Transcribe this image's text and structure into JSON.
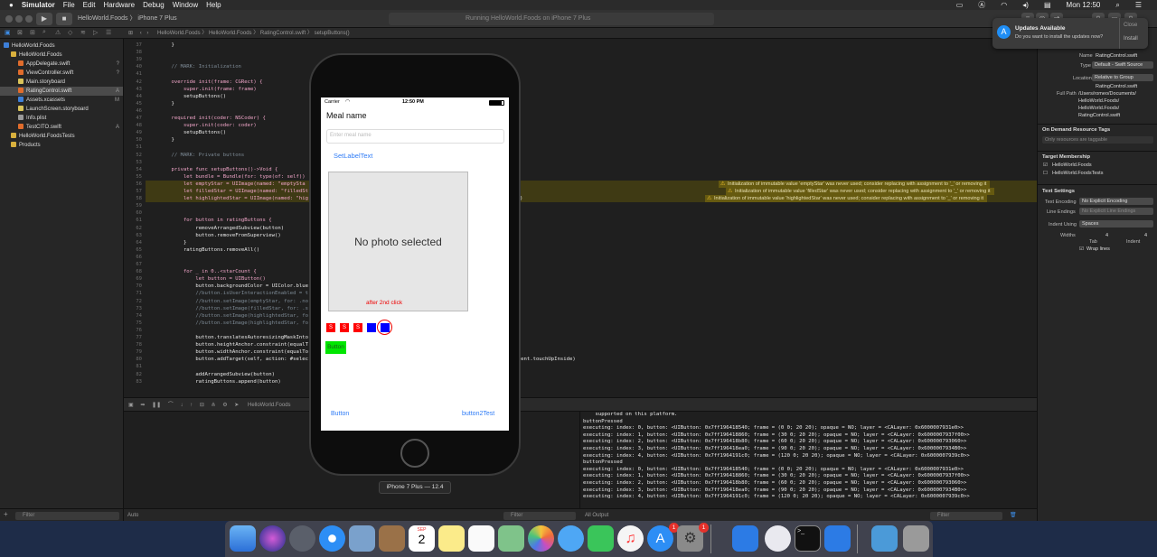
{
  "menubar": {
    "apple": "",
    "app": "Simulator",
    "items": [
      "File",
      "Edit",
      "Hardware",
      "Debug",
      "Window",
      "Help"
    ],
    "clock": "Mon 12:50"
  },
  "toolbar": {
    "scheme": "HelloWorld.Foods",
    "device": "iPhone 7 Plus",
    "status": "Running HelloWorld.Foods on iPhone 7 Plus"
  },
  "jumpbar": {
    "items": [
      "HelloWorld.Foods",
      "HelloWorld.Foods",
      "RatingControl.swift",
      "setupButtons()"
    ]
  },
  "navigator": {
    "items": [
      {
        "label": "HelloWorld.Foods",
        "badge": "",
        "indent": 0,
        "color": "#3d7fd8"
      },
      {
        "label": "HelloWorld.Foods",
        "badge": "",
        "indent": 1,
        "color": "#d8b03d"
      },
      {
        "label": "AppDelegate.swift",
        "badge": "?",
        "indent": 2,
        "color": "#e06c2c"
      },
      {
        "label": "ViewController.swift",
        "badge": "?",
        "indent": 2,
        "color": "#e06c2c"
      },
      {
        "label": "Main.storyboard",
        "badge": "",
        "indent": 2,
        "color": "#d9c35a"
      },
      {
        "label": "RatingControl.swift",
        "badge": "A",
        "indent": 2,
        "color": "#e06c2c"
      },
      {
        "label": "Assets.xcassets",
        "badge": "M",
        "indent": 2,
        "color": "#3d7fd8"
      },
      {
        "label": "LaunchScreen.storyboard",
        "badge": "",
        "indent": 2,
        "color": "#d9c35a"
      },
      {
        "label": "Info.plist",
        "badge": "",
        "indent": 2,
        "color": "#999999"
      },
      {
        "label": "TestCITO.swift",
        "badge": "A",
        "indent": 2,
        "color": "#e06c2c"
      },
      {
        "label": "HelloWorld.FoodsTests",
        "badge": "",
        "indent": 1,
        "color": "#d8b03d"
      },
      {
        "label": "Products",
        "badge": "",
        "indent": 1,
        "color": "#d8b03d"
      }
    ],
    "filter_placeholder": "Filter"
  },
  "editor": {
    "lines": [
      {
        "n": "37",
        "t": "    }"
      },
      {
        "n": "38",
        "t": ""
      },
      {
        "n": "39",
        "t": ""
      },
      {
        "n": "40",
        "t": "    // MARK: Initialization"
      },
      {
        "n": "41",
        "t": ""
      },
      {
        "n": "42",
        "t": "    override init(frame: CGRect) {"
      },
      {
        "n": "43",
        "t": "        super.init(frame: frame)"
      },
      {
        "n": "44",
        "t": "        setupButtons()"
      },
      {
        "n": "45",
        "t": "    }"
      },
      {
        "n": "46",
        "t": ""
      },
      {
        "n": "47",
        "t": "    required init(coder: NSCoder) {"
      },
      {
        "n": "48",
        "t": "        super.init(coder: coder)"
      },
      {
        "n": "49",
        "t": "        setupButtons()"
      },
      {
        "n": "50",
        "t": "    }"
      },
      {
        "n": "51",
        "t": ""
      },
      {
        "n": "52",
        "t": "    // MARK: Private buttons"
      },
      {
        "n": "53",
        "t": ""
      },
      {
        "n": "54",
        "t": "    private func setupButtons()->Void {"
      },
      {
        "n": "55",
        "t": "        let bundle = Bundle(for: type(of: self))"
      },
      {
        "n": "56",
        "t": "        let emptyStar = UIImage(named: \"emptySta"
      },
      {
        "n": "57",
        "t": "        let filledStar = UIImage(named: \"filledSt"
      },
      {
        "n": "58",
        "t": "        let highlightedStar = UIImage(named: \"hig"
      },
      {
        "n": "59",
        "t": ""
      },
      {
        "n": "60",
        "t": ""
      },
      {
        "n": "61",
        "t": "        for button in ratingButtons {"
      },
      {
        "n": "62",
        "t": "            removeArrangedSubview(button)"
      },
      {
        "n": "63",
        "t": "            button.removeFromSuperview()"
      },
      {
        "n": "64",
        "t": "        }"
      },
      {
        "n": "65",
        "t": "        ratingButtons.removeAll()"
      },
      {
        "n": "66",
        "t": ""
      },
      {
        "n": "67",
        "t": ""
      },
      {
        "n": "68",
        "t": "        for _ in 0..<starCount {"
      },
      {
        "n": "69",
        "t": "            let button = UIButton()"
      },
      {
        "n": "70",
        "t": "            button.backgroundColor = UIColor.blue"
      },
      {
        "n": "71",
        "t": "            //button.isUserInteractionEnabled = t"
      },
      {
        "n": "72",
        "t": "            //button.setImage(emptyStar, for: .no"
      },
      {
        "n": "73",
        "t": "            //button.setImage(filledStar, for: .s"
      },
      {
        "n": "74",
        "t": "            //button.setImage(highlightedStar, fo"
      },
      {
        "n": "75",
        "t": "            //button.setImage(highlightedStar, fo"
      },
      {
        "n": "76",
        "t": ""
      },
      {
        "n": "77",
        "t": "            button.translatesAutoresizingMaskInto"
      },
      {
        "n": "78",
        "t": "            button.heightAnchor.constraint(equalT"
      },
      {
        "n": "79",
        "t": "            button.widthAnchor.constraint(equalTo"
      },
      {
        "n": "80",
        "t": "            button.addTarget(self, action: #selec"
      },
      {
        "n": "81",
        "t": ""
      },
      {
        "n": "82",
        "t": "            addArrangedSubview(button)"
      },
      {
        "n": "83",
        "t": "            ratingButtons.append(button)"
      }
    ],
    "warnings": [
      "Initialization of immutable value 'emptyStar' was never used; consider replacing with assignment to '_' or removing it",
      "Initialization of immutable value 'filledStar' was never used; consider replacing with assignment to '_' or removing it",
      "Initialization of immutable value 'highlightedStar' was never used; consider replacing with assignment to '_' or removing it"
    ],
    "line_tail_58": ")",
    "line_tail_80": ".Event.touchUpInside)"
  },
  "debugbar": {
    "target": "HelloWorld.Foods"
  },
  "console": {
    "lines": [
      "    supported on this platform.",
      "buttonPressed",
      "executing: index: 0, button: <UIButton: 0x7ff196418540; frame = (0 0; 20 20); opaque = NO; layer = <CALayer: 0x6000007931e0>>",
      "executing: index: 1, button: <UIButton: 0x7ff196418860; frame = (30 0; 20 20); opaque = NO; layer = <CALayer: 0x6000007937f00>>",
      "executing: index: 2, button: <UIButton: 0x7ff196418b80; frame = (60 0; 20 20); opaque = NO; layer = <CALayer: 0x600000793060>>",
      "executing: index: 3, button: <UIButton: 0x7ff196418ea0; frame = (90 0; 20 20); opaque = NO; layer = <CALayer: 0x6000007934B0>>",
      "executing: index: 4, button: <UIButton: 0x7ff1964191c0; frame = (120 0; 20 20); opaque = NO; layer = <CALayer: 0x6000007939c0>>",
      "buttonPressed",
      "executing: index: 0, button: <UIButton: 0x7ff196418540; frame = (0 0; 20 20); opaque = NO; layer = <CALayer: 0x6000007931e0>>",
      "executing: index: 1, button: <UIButton: 0x7ff196418860; frame = (30 0; 20 20); opaque = NO; layer = <CALayer: 0x6000007937f00>>",
      "executing: index: 2, button: <UIButton: 0x7ff196418b80; frame = (60 0; 20 20); opaque = NO; layer = <CALayer: 0x600000793060>>",
      "executing: index: 3, button: <UIButton: 0x7ff196418ea0; frame = (90 0; 20 20); opaque = NO; layer = <CALayer: 0x6000007934B0>>",
      "executing: index: 4, button: <UIButton: 0x7ff1964191c0; frame = (120 0; 20 20); opaque = NO; layer = <CALayer: 0x6000007939c0>>"
    ],
    "output_selector": "All Output",
    "filter_placeholder": "Filter"
  },
  "bottombar": {
    "auto": "Auto",
    "filter_placeholder": "Filter"
  },
  "inspector": {
    "name_label": "Name",
    "name_value": "RatingControl.swift",
    "type_label": "Type",
    "type_value": "Default - Swift Source",
    "location_label": "Location",
    "location_value": "Relative to Group",
    "location_file": "RatingControl.swift",
    "fullpath_label": "Full Path",
    "fullpath_lines": [
      "/Users/romeo/Documents/",
      "HelloWorld.Foods/",
      "HelloWorld.Foods/",
      "RatingControl.swift"
    ],
    "odr_header": "On Demand Resource Tags",
    "odr_placeholder": "Only resources are taggable",
    "membership_header": "Target Membership",
    "membership_items": [
      "HelloWorld.Foods",
      "HelloWorld.FoodsTests"
    ],
    "textsettings_header": "Text Settings",
    "encoding_label": "Text Encoding",
    "encoding_value": "No Explicit Encoding",
    "lineendings_label": "Line Endings",
    "lineendings_value": "No Explicit Line Endings",
    "indent_label": "Indent Using",
    "indent_value": "Spaces",
    "widths_label": "Widths",
    "tab_value": "4",
    "indent_width_value": "4",
    "tab_label": "Tab",
    "indent_sub_label": "Indent",
    "wrap_label": "Wrap lines"
  },
  "notification": {
    "title": "Updates Available",
    "body": "Do you want to install the updates now?",
    "close": "Close",
    "install": "Install"
  },
  "simulator": {
    "label": "iPhone 7 Plus — 12.4",
    "carrier": "Carrier",
    "time": "12:50 PM",
    "title": "Meal name",
    "meal_placeholder": "Enter meal name",
    "set_label": "SetLabelText",
    "no_photo": "No photo selected",
    "after_click": "after 2nd click",
    "stars": [
      "S",
      "S",
      "S"
    ],
    "button_green": "Button",
    "button_left": "Button",
    "button_right": "button2Test",
    "accent": "#2f7cf6"
  },
  "dock": {
    "calendar_month": "SEP",
    "calendar_day": "2",
    "badge_appstore": "1",
    "badge_prefs": "1"
  }
}
